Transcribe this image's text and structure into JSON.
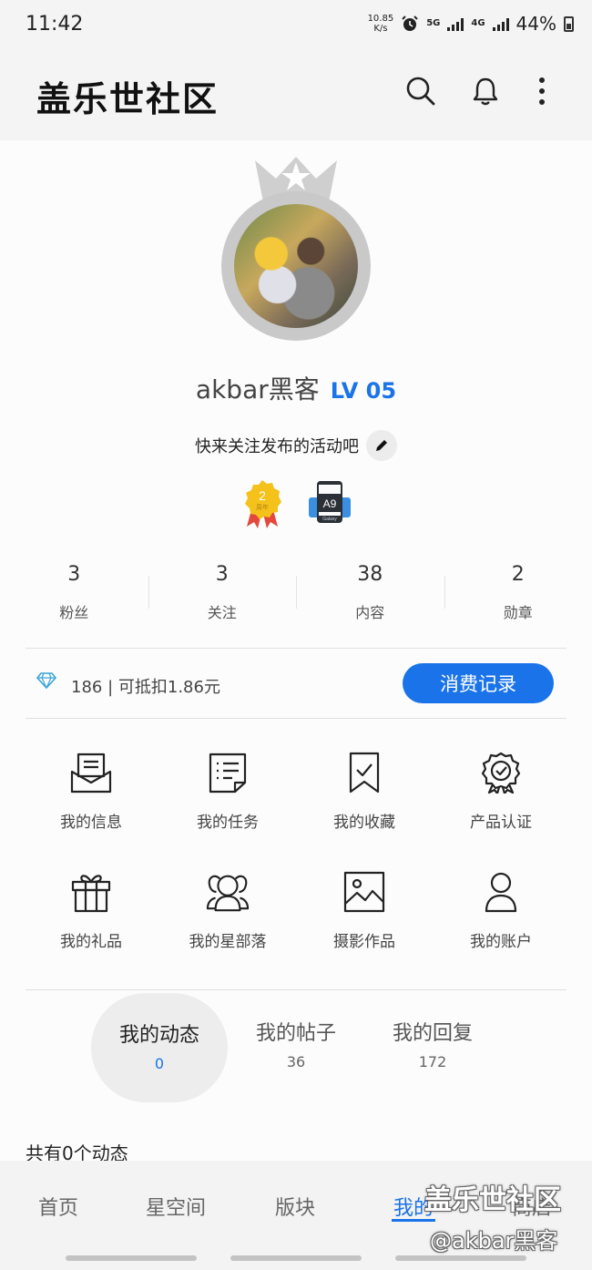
{
  "status_bar": {
    "time": "11:42",
    "net_speed_value": "10.85",
    "net_speed_unit": "K/s",
    "network_5g": "5G",
    "network_4g": "4G",
    "battery": "44%",
    "icons": [
      "alarm-icon",
      "signal-icon",
      "battery-icon"
    ]
  },
  "header": {
    "title": "盖乐世社区",
    "icons": [
      "search-icon",
      "bell-icon",
      "more-icon"
    ]
  },
  "profile": {
    "username": "akbar黑客",
    "level": "LV 05",
    "bio": "快来关注发布的活动吧",
    "badges": [
      {
        "name": "anniversary-badge",
        "label": "2",
        "sub": "周年",
        "color": "#f4c21b"
      },
      {
        "name": "galaxy-a9-badge",
        "label": "A9",
        "sub": "Galaxy",
        "color": "#3b8fe0"
      }
    ]
  },
  "stats": [
    {
      "value": "3",
      "label": "粉丝"
    },
    {
      "value": "3",
      "label": "关注"
    },
    {
      "value": "38",
      "label": "内容"
    },
    {
      "value": "2",
      "label": "勋章"
    }
  ],
  "points": {
    "text": "186 | 可抵扣1.86元",
    "button": "消费记录"
  },
  "menu": [
    {
      "label": "我的信息",
      "icon": "message-icon"
    },
    {
      "label": "我的任务",
      "icon": "task-list-icon"
    },
    {
      "label": "我的收藏",
      "icon": "bookmark-icon"
    },
    {
      "label": "产品认证",
      "icon": "certified-icon"
    },
    {
      "label": "我的礼品",
      "icon": "gift-icon"
    },
    {
      "label": "我的星部落",
      "icon": "group-icon"
    },
    {
      "label": "摄影作品",
      "icon": "image-icon"
    },
    {
      "label": "我的账户",
      "icon": "user-icon"
    }
  ],
  "tabs": [
    {
      "label": "我的动态",
      "count": "0",
      "active": true
    },
    {
      "label": "我的帖子",
      "count": "36",
      "active": false
    },
    {
      "label": "我的回复",
      "count": "172",
      "active": false
    }
  ],
  "post_count_text": "共有0个动态",
  "bottom_nav": [
    {
      "label": "首页",
      "active": false
    },
    {
      "label": "星空间",
      "active": false
    },
    {
      "label": "版块",
      "active": false
    },
    {
      "label": "我的",
      "active": true
    },
    {
      "label": "商店",
      "active": false
    }
  ],
  "watermark": {
    "line1": "盖乐世社区",
    "line2": "@akbar黑客"
  },
  "colors": {
    "accent": "#1a73e8",
    "background": "#fcfcfc"
  }
}
